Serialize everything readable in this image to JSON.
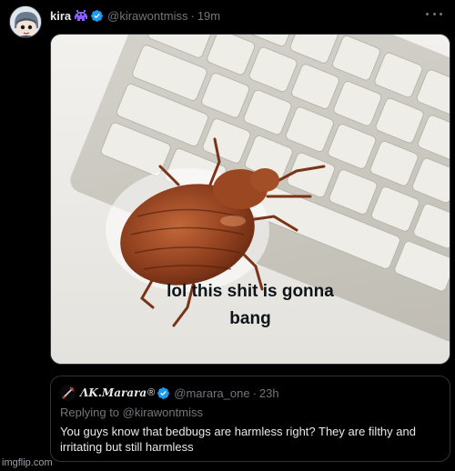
{
  "tweet": {
    "display_name": "kira",
    "handle": "@kirawontmiss",
    "separator": "·",
    "time": "19m",
    "avatar_icon": "cartoon-avatar-icon",
    "emoji_icon": "alien-invader-icon",
    "verified_icon": "verified-badge-icon",
    "more_icon": "more-options-icon"
  },
  "media": {
    "caption_line1": "lol this shit is gonna",
    "caption_line2": "bang"
  },
  "quote": {
    "display_name": "ΛK.Marara",
    "registered_mark": "®",
    "handle": "@marara_one",
    "separator": "·",
    "time": "23h",
    "replying_to": "Replying to @kirawontmiss",
    "text": "You guys know that bedbugs are harmless right? They are filthy and irritating but still harmless"
  },
  "watermark": "imgflip.com",
  "colors": {
    "background": "#000000",
    "text_primary": "#e7e9ea",
    "text_secondary": "#71767b",
    "border": "#2f3336",
    "verified": "#1d9bf0",
    "emoji": "#8b5cf6"
  }
}
